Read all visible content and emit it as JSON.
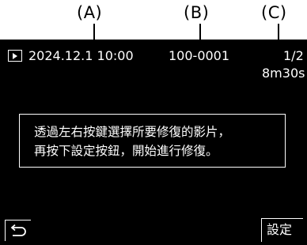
{
  "callouts": {
    "a": "(A)",
    "b": "(B)",
    "c": "(C)"
  },
  "status_bar": {
    "mode_icon": "playback-icon",
    "datetime": "2024.12.1  10:00",
    "file_number": "100-0001",
    "page_indicator": "1/2",
    "duration": "8m30s"
  },
  "message": {
    "line1": "透過左右按鍵選擇所要修復的影片，",
    "line2": "再按下設定按鈕，開始進行修復。"
  },
  "footer": {
    "back_icon": "return-arrow-icon",
    "set_label": "設定"
  }
}
